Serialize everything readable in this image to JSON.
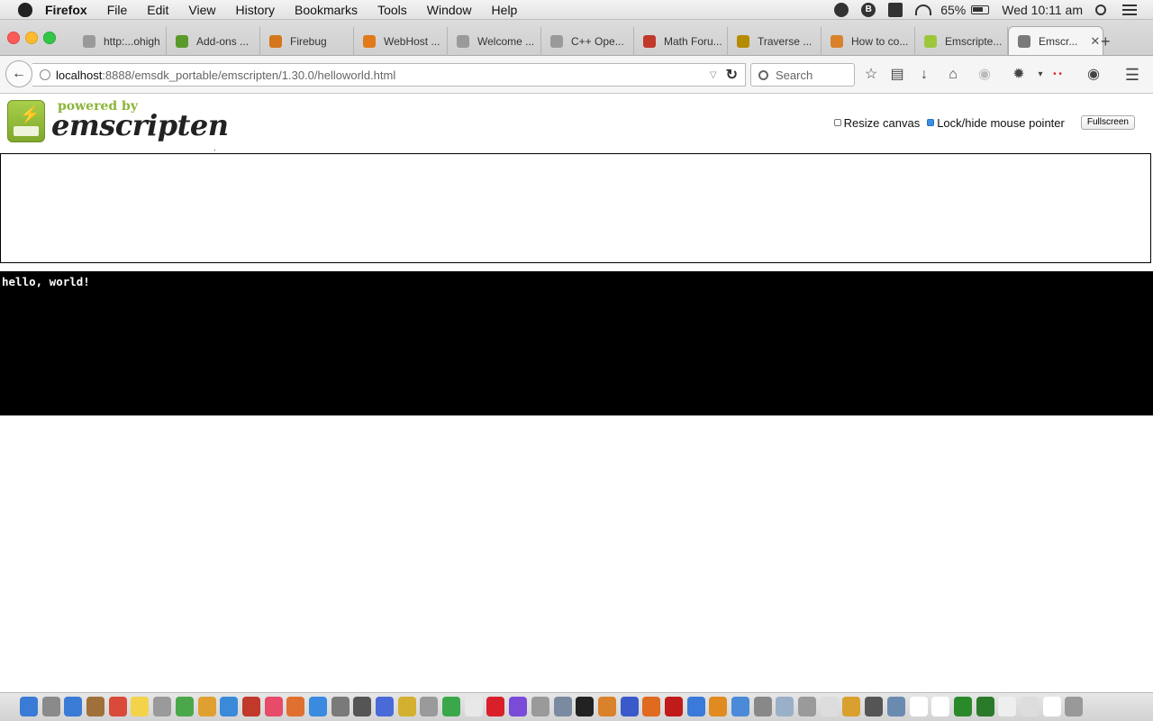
{
  "menubar": {
    "app": "Firefox",
    "items": [
      "File",
      "Edit",
      "View",
      "History",
      "Bookmarks",
      "Tools",
      "Window",
      "Help"
    ],
    "status": {
      "battery": "65%",
      "clock": "Wed 10:11 am",
      "icon_b": "B"
    }
  },
  "tabs": [
    {
      "label": "http:...ohigh",
      "color": "#9a9a9a"
    },
    {
      "label": "Add-ons ...",
      "color": "#5a9a2a"
    },
    {
      "label": "Firebug",
      "color": "#d4761c"
    },
    {
      "label": "WebHost ...",
      "color": "#e07a1a"
    },
    {
      "label": "Welcome ...",
      "color": "#9a9a9a"
    },
    {
      "label": "C++ Ope...",
      "color": "#9a9a9a"
    },
    {
      "label": "Math Foru...",
      "color": "#c0392b"
    },
    {
      "label": "Traverse ...",
      "color": "#b58b00"
    },
    {
      "label": "How to co...",
      "color": "#d9822b"
    },
    {
      "label": "Emscripte...",
      "color": "#9dc73a"
    },
    {
      "label": "Emscr...",
      "color": "#7a7a7a",
      "active": true
    }
  ],
  "navbar": {
    "url_host": "localhost",
    "url_rest": ":8888/emsdk_portable/emscripten/1.30.0/helloworld.html",
    "search_placeholder": "Search"
  },
  "page": {
    "logo_tagline": "powered by",
    "logo_brand": "emscripten",
    "resize_canvas_label": "Resize canvas",
    "resize_canvas_checked": false,
    "lock_pointer_label": "Lock/hide mouse pointer",
    "lock_pointer_checked": true,
    "fullscreen_label": "Fullscreen",
    "output_text": "hello, world!"
  },
  "dock": {
    "colors": [
      "#3a7bd5",
      "#8a8a8a",
      "#3a7bd5",
      "#a0703a",
      "#d94a3a",
      "#f2d34a",
      "#9a9a9a",
      "#4aa84a",
      "#e0a030",
      "#3a8ad9",
      "#c0392b",
      "#e84a6a",
      "#e07030",
      "#3a8ae0",
      "#7a7a7a",
      "#555",
      "#4a6ad9",
      "#d4b030",
      "#9a9a9a",
      "#3aa84a",
      "#e8e8e8",
      "#d9202a",
      "#7a4ad9",
      "#9a9a9a",
      "#7a8aa0",
      "#222",
      "#d9822b",
      "#3a5ac9",
      "#e06a20",
      "#c01a1a",
      "#3a7ad9",
      "#e08a20",
      "#4a8ad9",
      "#888",
      "#9ab0c9",
      "#9a9a9a",
      "#ddd",
      "#d9a030",
      "#555",
      "#6a8ab0",
      "#fff",
      "#fff",
      "#2a8a2a",
      "#2a7a2a",
      "#eee",
      "#ddd",
      "#fff",
      "#999"
    ]
  }
}
